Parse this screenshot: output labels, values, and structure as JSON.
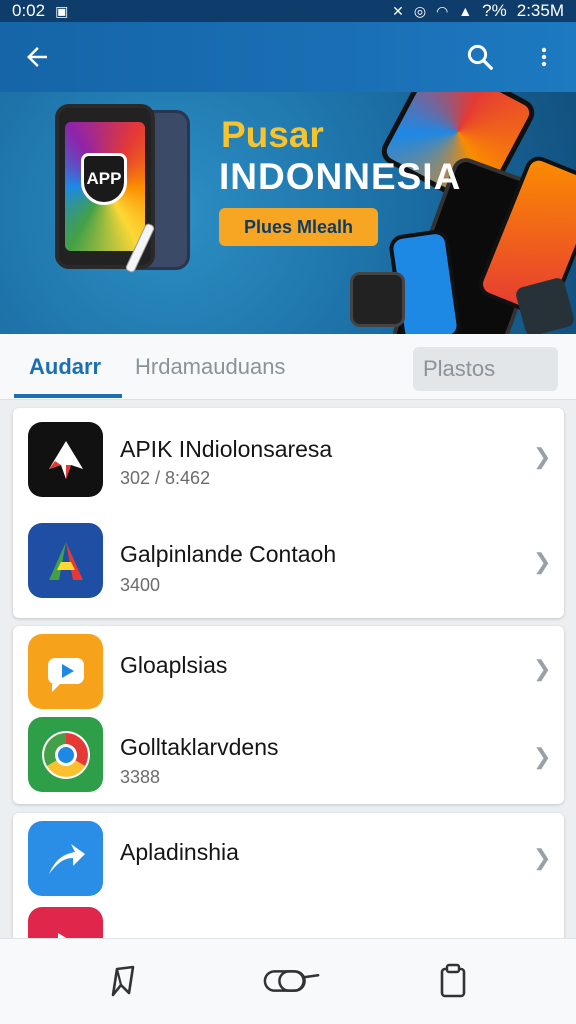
{
  "status_bar": {
    "time": "0:02",
    "right_text": "2:35M",
    "battery_text": "?%"
  },
  "app_bar": {
    "back_icon": "arrow-left-icon",
    "search_icon": "search-icon",
    "more_icon": "more-vert-icon"
  },
  "banner": {
    "title_line1": "Pusar",
    "title_line2": "INDONNESIA",
    "button_label": "Plues Mlealh",
    "badge_text": "APP",
    "active_slide": 1,
    "slide_count": 3
  },
  "tabs": [
    {
      "label": "Audarr",
      "selected": true
    },
    {
      "label": "Hrdamauduans",
      "selected": false
    },
    {
      "label": "Plastos",
      "selected": false
    }
  ],
  "apps": [
    {
      "name": "APIK INdiolonsaresa",
      "subtitle": "302 / 8:462",
      "icon": "arrow-up-icon",
      "icon_color": "#111111"
    },
    {
      "name": "Galpinlande Contaoh",
      "subtitle": "3400",
      "icon": "triangle-a-icon",
      "icon_color": "#1e4fa5"
    },
    {
      "name": "Gloaplsias",
      "subtitle": "",
      "icon": "play-chat-icon",
      "icon_color": "#f7a21b"
    },
    {
      "name": "Golltaklarvdens",
      "subtitle": "3388",
      "icon": "chrome-icon",
      "icon_color": "#2e9e48"
    },
    {
      "name": "Apladinshia",
      "subtitle": "",
      "icon": "share-arrow-icon",
      "icon_color": "#2a8ee6"
    },
    {
      "name": "",
      "subtitle": "",
      "icon": "play-icon",
      "icon_color": "#e0264b"
    }
  ],
  "bottom_nav": [
    {
      "icon": "bookmark-send-icon"
    },
    {
      "icon": "controller-icon"
    },
    {
      "icon": "clipboard-icon"
    }
  ],
  "colors": {
    "primary": "#1a6fb4",
    "accent": "#f6a623",
    "banner_title": "#f7c32e"
  }
}
